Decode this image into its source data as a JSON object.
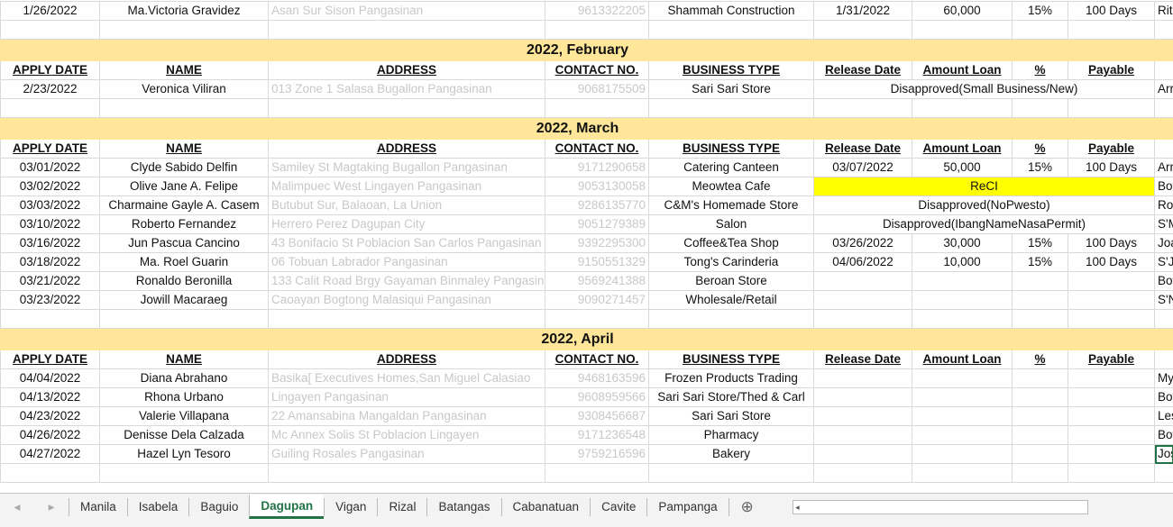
{
  "columns": [
    "APPLY DATE",
    "NAME",
    "ADDRESS",
    "CONTACT NO.",
    "BUSINESS TYPE",
    "Release Date",
    "Amount Loan",
    "%",
    "Payable"
  ],
  "top_row": {
    "date": "1/26/2022",
    "name": "Ma.Victoria Gravidez",
    "address": "Asan Sur Sison Pangasinan",
    "contact": "9613322205",
    "business": "Shammah Construction",
    "release": "1/31/2022",
    "amount": "60,000",
    "pct": "15%",
    "payable": "100 Days",
    "extra": "Rit"
  },
  "sections": [
    {
      "title": "2022, February",
      "rows": [
        {
          "date": "2/23/2022",
          "name": "Veronica Viliran",
          "address": "013 Zone 1 Salasa Bugallon Pangasinan",
          "contact": "9068175509",
          "business": "Sari Sari Store",
          "status": "Disapproved(Small Business/New)",
          "extra": "Arr"
        }
      ]
    },
    {
      "title": "2022, March",
      "rows": [
        {
          "date": "03/01/2022",
          "name": "Clyde Sabido Delfin",
          "address": "Samiley St Magtaking Bugallon Pangasinan",
          "contact": "9171290658",
          "business": "Catering Canteen",
          "release": "03/07/2022",
          "amount": "50,000",
          "pct": "15%",
          "payable": "100 Days",
          "extra": "Arr"
        },
        {
          "date": "03/02/2022",
          "name": "Olive Jane A. Felipe",
          "address": "Malimpuec West Lingayen Pangasinan",
          "contact": "9053130058",
          "business": "Meowtea Cafe",
          "status": "ReCI",
          "highlight": "#ffff00",
          "extra": "Bov"
        },
        {
          "date": "03/03/2022",
          "name": "Charmaine Gayle A. Casem",
          "address": "Butubut Sur, Balaoan, La Union",
          "contact": "9286135770",
          "business": "C&M's Homemade Store",
          "status": "Disapproved(NoPwesto)",
          "extra": "Roc"
        },
        {
          "date": "03/10/2022",
          "name": "Roberto Fernandez",
          "address": "Herrero Perez Dagupan City",
          "contact": "9051279389",
          "business": "Salon",
          "status": "Disapproved(IbangNameNasaPermit)",
          "extra": "S'M"
        },
        {
          "date": "03/16/2022",
          "name": "Jun Pascua Cancino",
          "address": "43 Bonifacio St Poblacion San Carlos Pangasinan",
          "contact": "9392295300",
          "business": "Coffee&Tea Shop",
          "release": "03/26/2022",
          "amount": "30,000",
          "pct": "15%",
          "payable": "100 Days",
          "extra": "Joa"
        },
        {
          "date": "03/18/2022",
          "name": "Ma. Roel Guarin",
          "address": "06 Tobuan Labrador Pangasinan",
          "contact": "9150551329",
          "business": "Tong's Carinderia",
          "release": "04/06/2022",
          "amount": "10,000",
          "pct": "15%",
          "payable": "100 Days",
          "extra": "S'Je"
        },
        {
          "date": "03/21/2022",
          "name": "Ronaldo Beronilla",
          "address": "133 Calit Road Brgy Gayaman Binmaley Pangasinan",
          "contact": "9569241388",
          "business": "Beroan Store",
          "extra": "Bov"
        },
        {
          "date": "03/23/2022",
          "name": "Jowill Macaraeg",
          "address": "Caoayan Bogtong Malasiqui Pangasinan",
          "contact": "9090271457",
          "business": "Wholesale/Retail",
          "extra": "S'N"
        }
      ]
    },
    {
      "title": "2022, April",
      "rows": [
        {
          "date": "04/04/2022",
          "name": "Diana Abrahano",
          "address": "Basika[ Executives Homes,San Miguel Calasiao",
          "contact": "9468163596",
          "business": "Frozen Products Trading",
          "extra": "My"
        },
        {
          "date": "04/13/2022",
          "name": "Rhona Urbano",
          "address": "Lingayen Pangasinan",
          "contact": "9608959566",
          "business": "Sari Sari Store/Thed  & Carl",
          "extra": "Bov"
        },
        {
          "date": "04/23/2022",
          "name": "Valerie Villapana",
          "address": "22 Amansabina Mangaldan Pangasinan",
          "contact": "9308456687",
          "business": "Sari Sari Store",
          "extra": "Les"
        },
        {
          "date": "04/26/2022",
          "name": "Denisse Dela Calzada",
          "address": "Mc Annex Solis St Poblacion Lingayen",
          "contact": "9171236548",
          "business": "Pharmacy",
          "extra": "Bov"
        },
        {
          "date": "04/27/2022",
          "name": "Hazel Lyn Tesoro",
          "address": "Guiling Rosales Pangasinan",
          "contact": "9759216596",
          "business": "Bakery",
          "extra": "Jos",
          "selected": true
        }
      ]
    }
  ],
  "sheet_tabs": [
    "Manila",
    "Isabela",
    "Baguio",
    "Dagupan",
    "Vigan",
    "Rizal",
    "Batangas",
    "Cabanatuan",
    "Cavite",
    "Pampanga"
  ],
  "active_tab": "Dagupan",
  "icons": {
    "add_sheet": "plus-circle-icon",
    "scroll_left": "triangle-left-icon"
  }
}
